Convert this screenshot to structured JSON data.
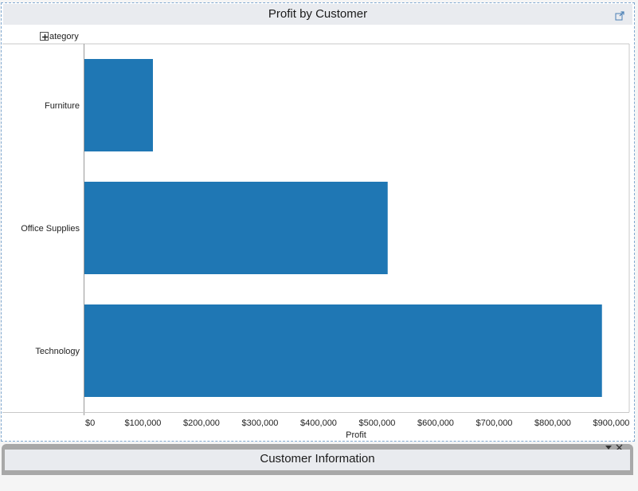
{
  "window": {
    "title": "Profit by Customer",
    "popout_icon": "popout-icon"
  },
  "header": {
    "category_label": "Category",
    "category_label_clipped": "ategory",
    "expand_icon": "plus-icon"
  },
  "bottom_panel": {
    "title": "Customer Information",
    "collapse_icon": "triangle-down-icon",
    "close_icon": "close-icon"
  },
  "chart_data": {
    "type": "bar",
    "orientation": "horizontal",
    "categories": [
      "Furniture",
      "Office Supplies",
      "Technology"
    ],
    "values": [
      117000,
      518000,
      884000
    ],
    "xlabel": "Profit",
    "ylabel": "Category",
    "xlim": [
      0,
      920000
    ],
    "x_ticks": [
      0,
      100000,
      200000,
      300000,
      400000,
      500000,
      600000,
      700000,
      800000,
      900000
    ],
    "x_tick_labels": [
      "$0",
      "$100,000",
      "$200,000",
      "$300,000",
      "$400,000",
      "$500,000",
      "$600,000",
      "$700,000",
      "$800,000",
      "$900,000"
    ],
    "bar_color": "#1f77b4",
    "grid": false
  }
}
